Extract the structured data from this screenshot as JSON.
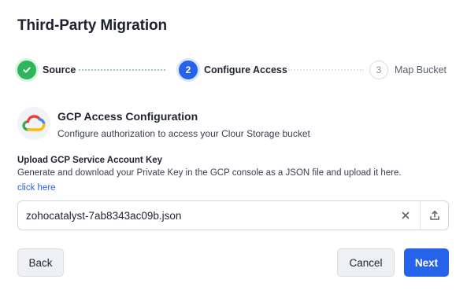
{
  "dialog": {
    "title": "Third-Party Migration"
  },
  "stepper": {
    "steps": [
      {
        "number": "1",
        "label": "Source",
        "state": "complete"
      },
      {
        "number": "2",
        "label": "Configure Access",
        "state": "active"
      },
      {
        "number": "3",
        "label": "Map Bucket",
        "state": "pending"
      }
    ]
  },
  "provider": {
    "icon": "google-cloud-icon",
    "title": "GCP Access Configuration",
    "subtitle": "Configure authorization to access your Clour Storage bucket"
  },
  "service_key": {
    "title": "Upload GCP Service Account Key",
    "description": "Generate and download your Private Key in the GCP console as a JSON file and upload it here.",
    "link_label": "click here",
    "file_name": "zohocatalyst-7ab8343ac09b.json"
  },
  "actions": {
    "back_label": "Back",
    "cancel_label": "Cancel",
    "next_label": "Next"
  },
  "colors": {
    "primary": "#2563eb",
    "success": "#2fb55c"
  }
}
